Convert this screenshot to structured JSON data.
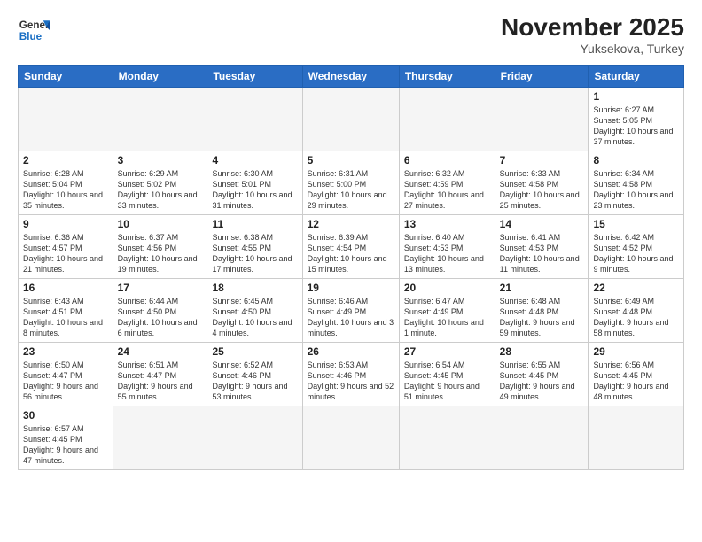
{
  "header": {
    "logo_general": "General",
    "logo_blue": "Blue",
    "month_title": "November 2025",
    "location": "Yuksekova, Turkey"
  },
  "weekdays": [
    "Sunday",
    "Monday",
    "Tuesday",
    "Wednesday",
    "Thursday",
    "Friday",
    "Saturday"
  ],
  "weeks": [
    [
      {
        "day": "",
        "info": ""
      },
      {
        "day": "",
        "info": ""
      },
      {
        "day": "",
        "info": ""
      },
      {
        "day": "",
        "info": ""
      },
      {
        "day": "",
        "info": ""
      },
      {
        "day": "",
        "info": ""
      },
      {
        "day": "1",
        "info": "Sunrise: 6:27 AM\nSunset: 5:05 PM\nDaylight: 10 hours\nand 37 minutes."
      }
    ],
    [
      {
        "day": "2",
        "info": "Sunrise: 6:28 AM\nSunset: 5:04 PM\nDaylight: 10 hours\nand 35 minutes."
      },
      {
        "day": "3",
        "info": "Sunrise: 6:29 AM\nSunset: 5:02 PM\nDaylight: 10 hours\nand 33 minutes."
      },
      {
        "day": "4",
        "info": "Sunrise: 6:30 AM\nSunset: 5:01 PM\nDaylight: 10 hours\nand 31 minutes."
      },
      {
        "day": "5",
        "info": "Sunrise: 6:31 AM\nSunset: 5:00 PM\nDaylight: 10 hours\nand 29 minutes."
      },
      {
        "day": "6",
        "info": "Sunrise: 6:32 AM\nSunset: 4:59 PM\nDaylight: 10 hours\nand 27 minutes."
      },
      {
        "day": "7",
        "info": "Sunrise: 6:33 AM\nSunset: 4:58 PM\nDaylight: 10 hours\nand 25 minutes."
      },
      {
        "day": "8",
        "info": "Sunrise: 6:34 AM\nSunset: 4:58 PM\nDaylight: 10 hours\nand 23 minutes."
      }
    ],
    [
      {
        "day": "9",
        "info": "Sunrise: 6:36 AM\nSunset: 4:57 PM\nDaylight: 10 hours\nand 21 minutes."
      },
      {
        "day": "10",
        "info": "Sunrise: 6:37 AM\nSunset: 4:56 PM\nDaylight: 10 hours\nand 19 minutes."
      },
      {
        "day": "11",
        "info": "Sunrise: 6:38 AM\nSunset: 4:55 PM\nDaylight: 10 hours\nand 17 minutes."
      },
      {
        "day": "12",
        "info": "Sunrise: 6:39 AM\nSunset: 4:54 PM\nDaylight: 10 hours\nand 15 minutes."
      },
      {
        "day": "13",
        "info": "Sunrise: 6:40 AM\nSunset: 4:53 PM\nDaylight: 10 hours\nand 13 minutes."
      },
      {
        "day": "14",
        "info": "Sunrise: 6:41 AM\nSunset: 4:53 PM\nDaylight: 10 hours\nand 11 minutes."
      },
      {
        "day": "15",
        "info": "Sunrise: 6:42 AM\nSunset: 4:52 PM\nDaylight: 10 hours\nand 9 minutes."
      }
    ],
    [
      {
        "day": "16",
        "info": "Sunrise: 6:43 AM\nSunset: 4:51 PM\nDaylight: 10 hours\nand 8 minutes."
      },
      {
        "day": "17",
        "info": "Sunrise: 6:44 AM\nSunset: 4:50 PM\nDaylight: 10 hours\nand 6 minutes."
      },
      {
        "day": "18",
        "info": "Sunrise: 6:45 AM\nSunset: 4:50 PM\nDaylight: 10 hours\nand 4 minutes."
      },
      {
        "day": "19",
        "info": "Sunrise: 6:46 AM\nSunset: 4:49 PM\nDaylight: 10 hours\nand 3 minutes."
      },
      {
        "day": "20",
        "info": "Sunrise: 6:47 AM\nSunset: 4:49 PM\nDaylight: 10 hours\nand 1 minute."
      },
      {
        "day": "21",
        "info": "Sunrise: 6:48 AM\nSunset: 4:48 PM\nDaylight: 9 hours\nand 59 minutes."
      },
      {
        "day": "22",
        "info": "Sunrise: 6:49 AM\nSunset: 4:48 PM\nDaylight: 9 hours\nand 58 minutes."
      }
    ],
    [
      {
        "day": "23",
        "info": "Sunrise: 6:50 AM\nSunset: 4:47 PM\nDaylight: 9 hours\nand 56 minutes."
      },
      {
        "day": "24",
        "info": "Sunrise: 6:51 AM\nSunset: 4:47 PM\nDaylight: 9 hours\nand 55 minutes."
      },
      {
        "day": "25",
        "info": "Sunrise: 6:52 AM\nSunset: 4:46 PM\nDaylight: 9 hours\nand 53 minutes."
      },
      {
        "day": "26",
        "info": "Sunrise: 6:53 AM\nSunset: 4:46 PM\nDaylight: 9 hours\nand 52 minutes."
      },
      {
        "day": "27",
        "info": "Sunrise: 6:54 AM\nSunset: 4:45 PM\nDaylight: 9 hours\nand 51 minutes."
      },
      {
        "day": "28",
        "info": "Sunrise: 6:55 AM\nSunset: 4:45 PM\nDaylight: 9 hours\nand 49 minutes."
      },
      {
        "day": "29",
        "info": "Sunrise: 6:56 AM\nSunset: 4:45 PM\nDaylight: 9 hours\nand 48 minutes."
      }
    ],
    [
      {
        "day": "30",
        "info": "Sunrise: 6:57 AM\nSunset: 4:45 PM\nDaylight: 9 hours\nand 47 minutes."
      },
      {
        "day": "",
        "info": ""
      },
      {
        "day": "",
        "info": ""
      },
      {
        "day": "",
        "info": ""
      },
      {
        "day": "",
        "info": ""
      },
      {
        "day": "",
        "info": ""
      },
      {
        "day": "",
        "info": ""
      }
    ]
  ]
}
